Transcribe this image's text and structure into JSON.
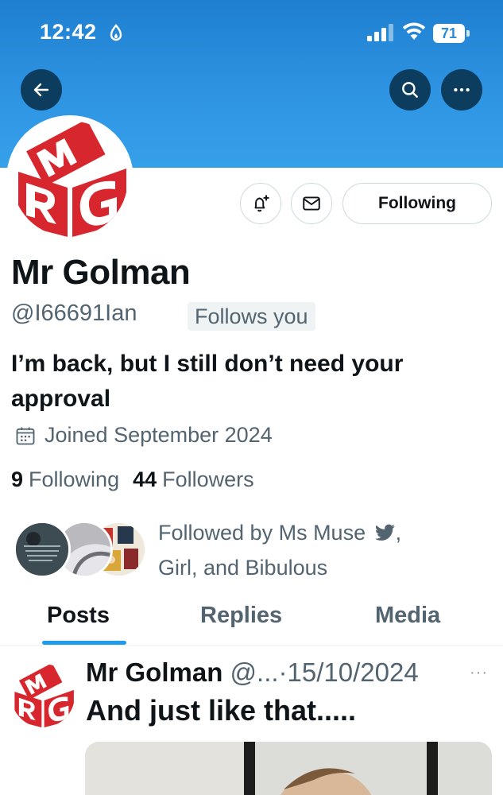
{
  "status_bar": {
    "time": "12:42",
    "battery": "71"
  },
  "profile": {
    "name": "Mr Golman",
    "handle": "@I66691Ian",
    "follows_you_badge": "Follows you",
    "bio": "I’m back, but I still don’t need your approval",
    "joined": "Joined September 2024",
    "following_count": "9",
    "following_label": "Following",
    "followers_count": "44",
    "followers_label": "Followers",
    "followed_by_prefix": "Followed by Ms Muse",
    "followed_by_suffix": ",",
    "followed_by_line2": "Girl, and Bibulous",
    "following_button": "Following"
  },
  "tabs": [
    {
      "label": "Posts",
      "active": true
    },
    {
      "label": "Replies",
      "active": false
    },
    {
      "label": "Media",
      "active": false
    }
  ],
  "post": {
    "author": "Mr Golman",
    "handle_truncated": "@...",
    "separator": "·",
    "date": "15/10/2024",
    "text": "And just like that.....",
    "more": "···"
  },
  "colors": {
    "banner": "#2e94e2",
    "accent": "#1d9bf0",
    "button_dark": "#0d3d5e",
    "secondary_text": "#536471",
    "logo_red": "#d7262d"
  },
  "icons": {
    "back": "arrow-left-icon",
    "search": "search-icon",
    "more": "more-horizontal-icon",
    "notify": "bell-plus-icon",
    "message": "envelope-icon",
    "calendar": "calendar-icon",
    "verified": "bird-icon"
  }
}
